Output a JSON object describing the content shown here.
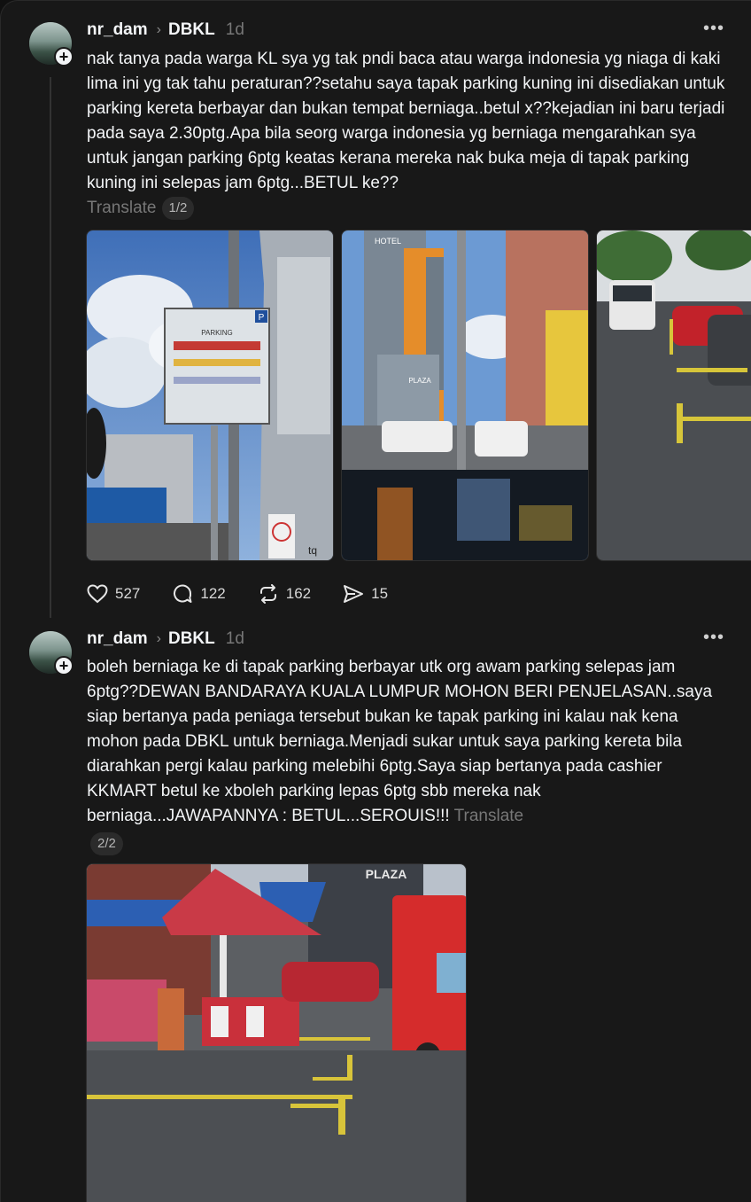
{
  "posts": [
    {
      "username": "nr_dam",
      "topic": "DBKL",
      "time": "1d",
      "text": "nak tanya pada warga KL sya yg tak pndi baca atau warga indonesia yg niaga di kaki lima ini yg tak tahu peraturan??setahu saya tapak parking kuning ini disediakan untuk parking kereta berbayar dan bukan tempat berniaga..betul x??kejadian ini baru terjadi pada saya 2.30ptg.Apa bila seorg warga indonesia yg berniaga mengarahkan sya untuk jangan parking 6ptg keatas kerana mereka nak buka meja di tapak parking kuning ini selepas jam 6ptg...BETUL ke??",
      "translate": "Translate",
      "page": "1/2",
      "likes": "527",
      "replies": "122",
      "reposts": "162",
      "shares": "15"
    },
    {
      "username": "nr_dam",
      "topic": "DBKL",
      "time": "1d",
      "text": "boleh berniaga ke di tapak parking berbayar utk org awam parking selepas jam 6ptg??DEWAN BANDARAYA KUALA LUMPUR MOHON BERI PENJELASAN..saya siap bertanya pada peniaga tersebut bukan ke tapak parking ini kalau nak kena mohon pada DBKL untuk berniaga.Menjadi sukar untuk saya parking kereta bila diarahkan pergi kalau parking melebihi 6ptg.Saya siap bertanya pada cashier KKMART betul ke xboleh parking lepas 6ptg sbb mereka nak berniaga...JAWAPANNYA : BETUL...SEROUIS!!!",
      "translate": "Translate",
      "page": "2/2"
    }
  ],
  "photo_text": {
    "hotel": "HOTEL",
    "plaza": "PLAZA",
    "plaza_big": "PLAZA",
    "parking_p": "P",
    "sign_title": "PARKING",
    "tq": "tq"
  },
  "icons": [
    "add-icon",
    "chevron-right-icon",
    "more-icon",
    "heart-icon",
    "comment-icon",
    "repost-icon",
    "share-icon"
  ],
  "colors": {
    "background": "#181818",
    "text": "#f3f5f7",
    "muted": "#777777"
  }
}
